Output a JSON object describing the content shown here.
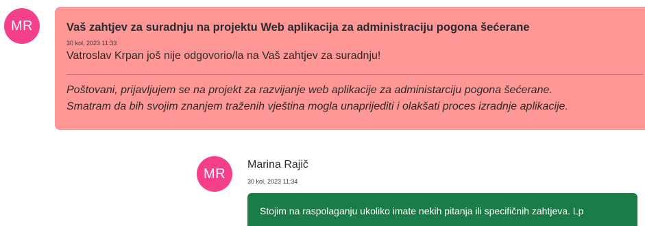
{
  "colors": {
    "avatar_bg": "#f43f8b",
    "request_card_bg": "#ff9797",
    "reply_bubble_bg": "#1a7c46"
  },
  "request": {
    "avatar_initials": "MR",
    "title": "Vaš zahtjev za suradnju na projektu Web aplikacija za administraciju pogona šećerane",
    "timestamp": "30 kol, 2023 11:33",
    "status_text": "Vatroslav Krpan još nije odgovorio/la na Vaš zahtjev za suradnju!",
    "message_lines": [
      "Poštovani, prijavljujem se na projekt za razvijanje web aplikacije za administarciju pogona šećerane.",
      "Smatram da bih svojim znanjem traženih vještina mogla unaprijediti i olakšati proces izradnje aplikacije."
    ]
  },
  "reply": {
    "avatar_initials": "MR",
    "author": "Marina Rajič",
    "timestamp": "30 kol, 2023 11:34",
    "text": "Stojim na raspolaganju ukoliko imate nekih pitanja ili specifičnih zahtjeva. Lp"
  }
}
